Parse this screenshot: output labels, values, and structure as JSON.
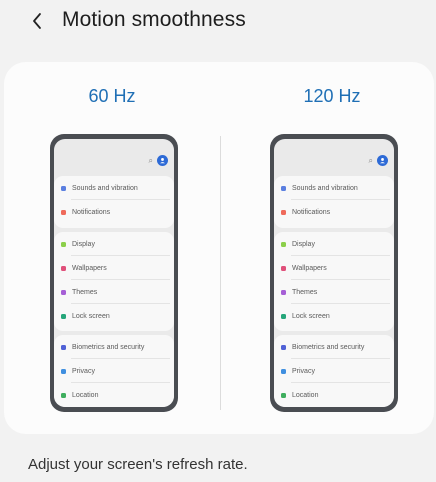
{
  "header": {
    "back_icon": "chevron-left-icon",
    "title": "Motion smoothness"
  },
  "options": [
    {
      "label": "60 Hz"
    },
    {
      "label": "120 Hz"
    }
  ],
  "preview": {
    "icons": [
      "search-icon",
      "account-icon"
    ],
    "groups": [
      [
        {
          "label": "Sounds and vibration",
          "color": "#5b7fe0"
        },
        {
          "label": "Notifications",
          "color": "#ef6a5b"
        }
      ],
      [
        {
          "label": "Display",
          "color": "#8ccf4a"
        },
        {
          "label": "Wallpapers",
          "color": "#e0507a"
        },
        {
          "label": "Themes",
          "color": "#a65fd6"
        },
        {
          "label": "Lock screen",
          "color": "#25a67a"
        }
      ],
      [
        {
          "label": "Biometrics and security",
          "color": "#5061d6"
        },
        {
          "label": "Privacy",
          "color": "#3f8fe0"
        },
        {
          "label": "Location",
          "color": "#3fae5e"
        }
      ]
    ]
  },
  "description": "Adjust your screen's refresh rate.",
  "colors": {
    "accent": "#1f6fb5",
    "profile": "#2d6ad6",
    "phone_frame": "#4a4d52"
  }
}
